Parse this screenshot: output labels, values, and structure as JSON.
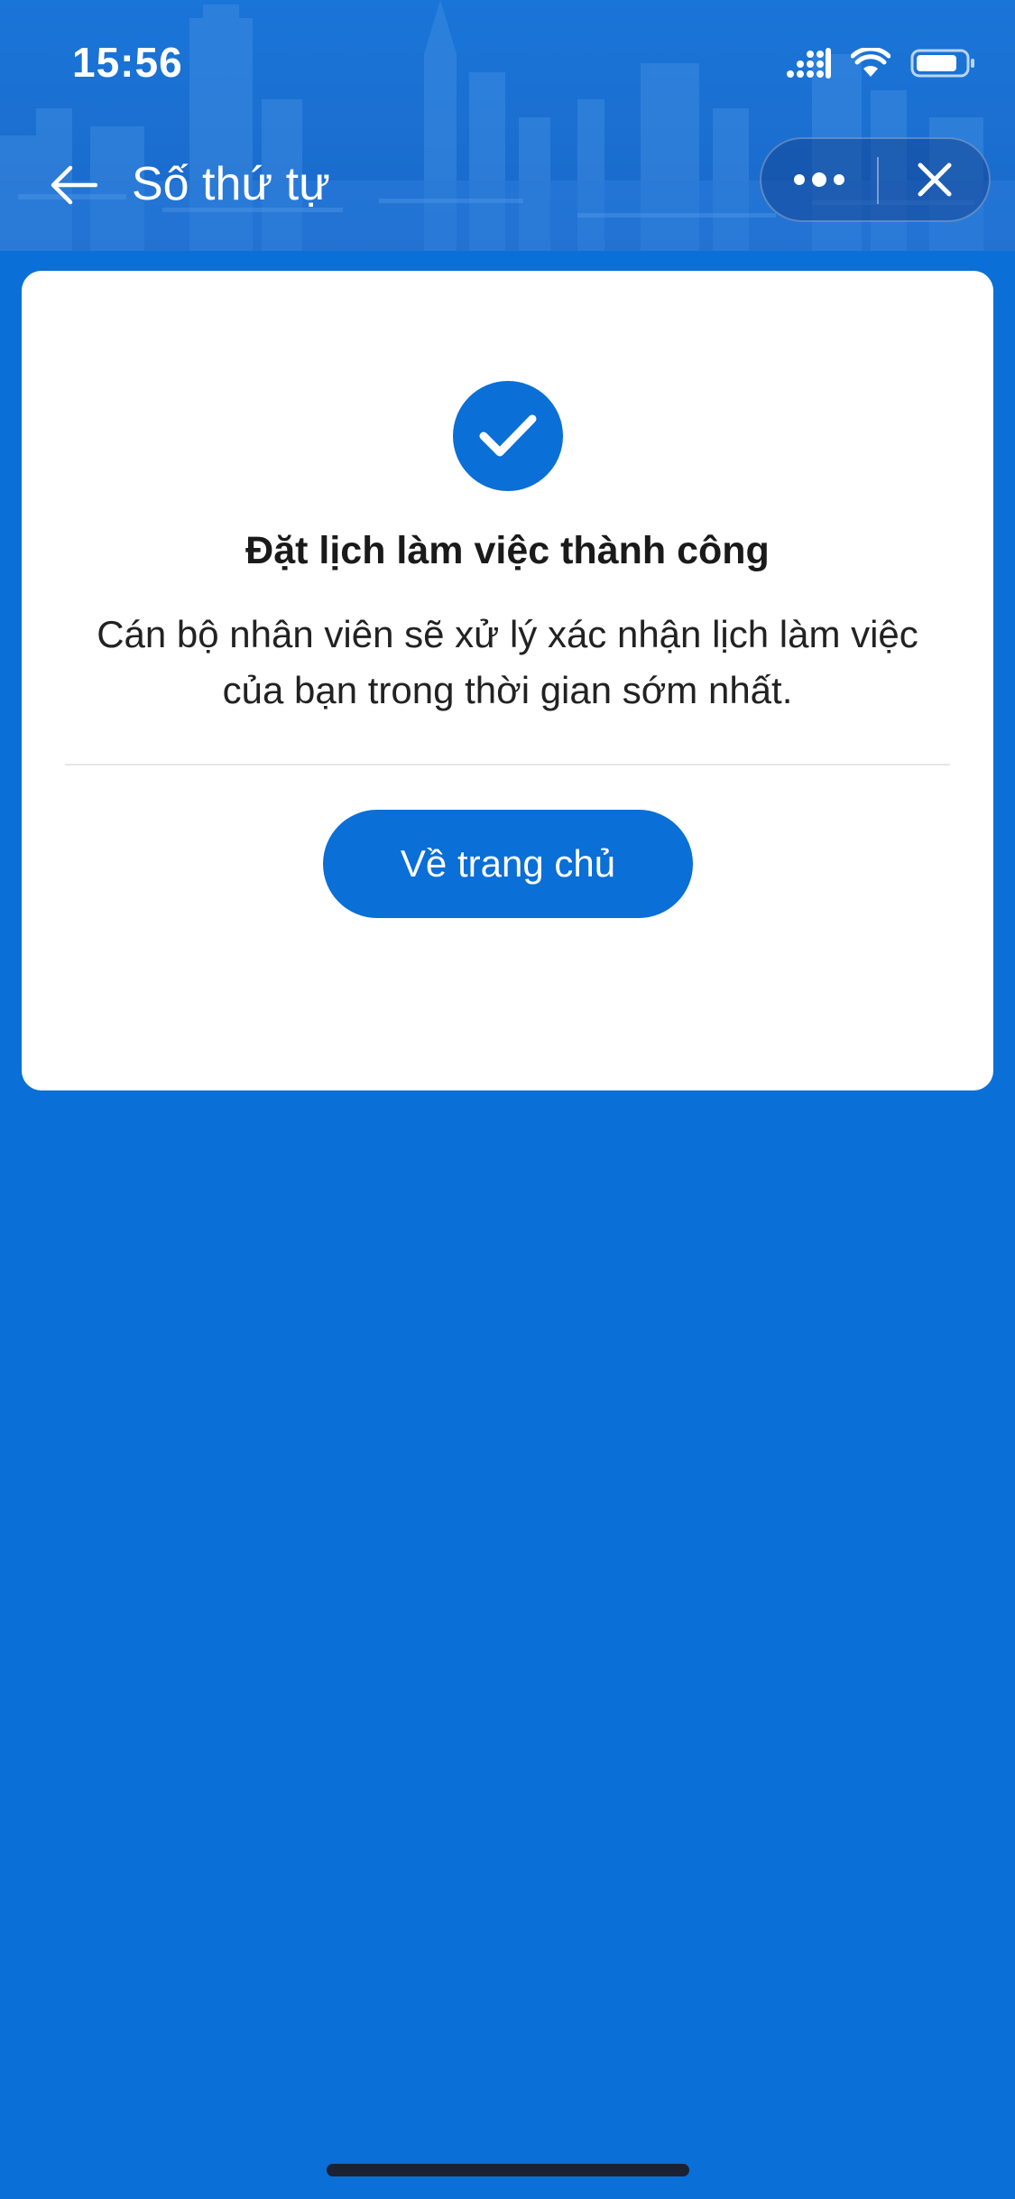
{
  "status_bar": {
    "time": "15:56",
    "icons": [
      "cellular-signal-icon",
      "wifi-icon",
      "battery-icon"
    ]
  },
  "nav": {
    "title": "Số thứ tự",
    "back_icon": "arrow-left-icon",
    "more_icon": "more-dots-icon",
    "close_icon": "close-icon"
  },
  "result": {
    "icon": "check-circle-icon",
    "title": "Đặt lịch làm việc thành công",
    "message": "Cán bộ nhân viên sẽ xử lý xác nhận lịch làm việc của bạn trong thời gian sớm nhất.",
    "home_button_label": "Về trang chủ"
  },
  "colors": {
    "primary": "#0a6fd6",
    "card_background": "#ffffff",
    "title_text": "#1a1a1a"
  }
}
